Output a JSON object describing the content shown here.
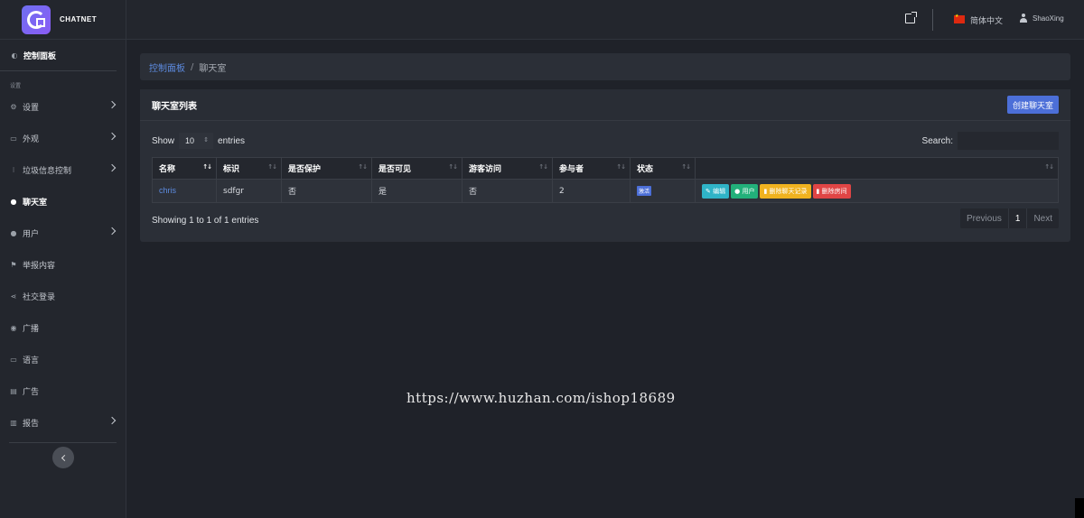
{
  "brand": {
    "name": "CHATNET"
  },
  "sidebar": {
    "dashboard": "控制面板",
    "section_label": "设置",
    "items": [
      {
        "label": "设置",
        "icon": "gear-icon",
        "chevron": true
      },
      {
        "label": "外观",
        "icon": "palette-icon",
        "chevron": true
      },
      {
        "label": "垃圾信息控制",
        "icon": "filter-icon",
        "chevron": true
      },
      {
        "label": "聊天室",
        "icon": "comments-icon",
        "chevron": false,
        "active": true
      },
      {
        "label": "用户",
        "icon": "users-icon",
        "chevron": true
      },
      {
        "label": "举报内容",
        "icon": "flag-icon",
        "chevron": false
      },
      {
        "label": "社交登录",
        "icon": "share-icon",
        "chevron": false
      },
      {
        "label": "广播",
        "icon": "broadcast-icon",
        "chevron": false
      },
      {
        "label": "语言",
        "icon": "keyboard-icon",
        "chevron": false
      },
      {
        "label": "广告",
        "icon": "ad-icon",
        "chevron": false
      },
      {
        "label": "报告",
        "icon": "chart-icon",
        "chevron": true
      }
    ]
  },
  "header": {
    "language": "简体中文",
    "username": "ShaoXing"
  },
  "breadcrumb": {
    "root": "控制面板",
    "separator": "/",
    "current": "聊天室"
  },
  "card": {
    "title": "聊天室列表",
    "create_button": "创建聊天室",
    "show_label": "Show",
    "entries_label": "entries",
    "page_length": "10",
    "search_label": "Search:",
    "search_value": ""
  },
  "table": {
    "columns": [
      "名称",
      "标识",
      "是否保护",
      "是否可见",
      "游客访问",
      "参与者",
      "状态",
      ""
    ],
    "rows": [
      {
        "name": "chris",
        "slug": "sdfgr",
        "protected": "否",
        "visible": "是",
        "guest": "否",
        "participants": "2",
        "status": "激活",
        "actions": {
          "edit": "编辑",
          "users": "用户",
          "clear": "删除聊天记录",
          "delete": "删除房间"
        }
      }
    ]
  },
  "footer": {
    "info": "Showing 1 to 1 of 1 entries",
    "prev": "Previous",
    "page": "1",
    "next": "Next"
  },
  "watermark": "https://www.huzhan.com/ishop18689",
  "colors": {
    "accent": "#4c6fd8",
    "edit": "#2fb3c7",
    "users": "#22b07a",
    "clear": "#f0b21f",
    "delete": "#e04545"
  }
}
